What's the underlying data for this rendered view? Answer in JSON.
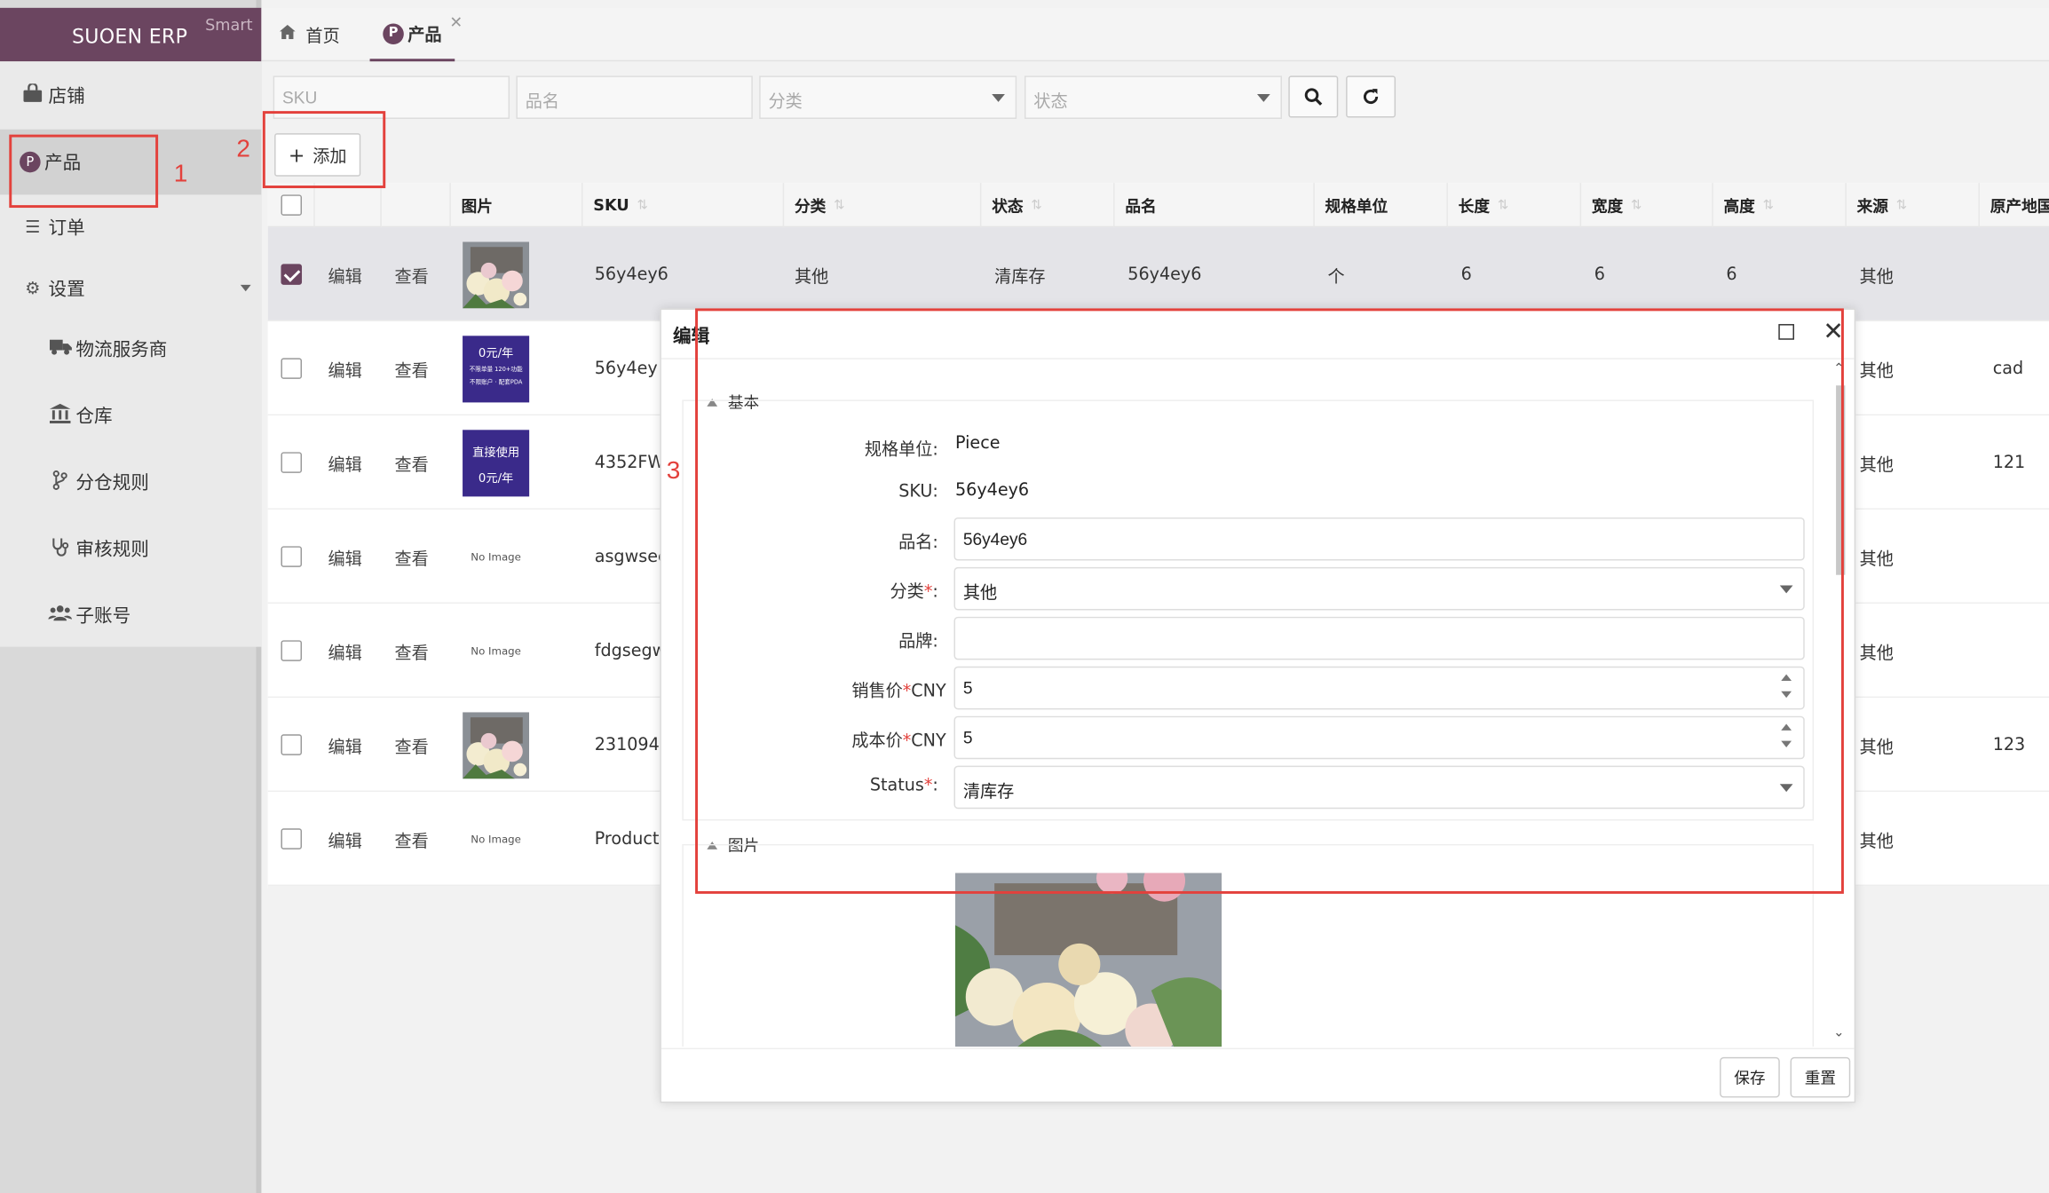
{
  "app": {
    "brand": "SUOEN ERP",
    "edition": "Smart"
  },
  "sidebar": {
    "items": [
      {
        "label": "店铺",
        "icon": "shopping-bag-icon"
      },
      {
        "label": "产品",
        "icon": "product-p-icon"
      },
      {
        "label": "订单",
        "icon": "list-icon"
      },
      {
        "label": "设置",
        "icon": "gear-icon"
      }
    ],
    "sub_items": [
      {
        "label": "物流服务商",
        "icon": "truck-icon"
      },
      {
        "label": "仓库",
        "icon": "bank-icon"
      },
      {
        "label": "分仓规则",
        "icon": "branch-icon"
      },
      {
        "label": "审核规则",
        "icon": "stethoscope-icon"
      },
      {
        "label": "子账号",
        "icon": "users-icon"
      }
    ]
  },
  "tabs": [
    {
      "label": "首页",
      "icon": "home-icon"
    },
    {
      "label": "产品",
      "icon": "product-p-icon",
      "active": true
    }
  ],
  "filters": {
    "sku_placeholder": "SKU",
    "name_placeholder": "品名",
    "category_placeholder": "分类",
    "status_placeholder": "状态"
  },
  "toolbar": {
    "add_label": "添加",
    "add_icon": "plus-icon"
  },
  "table": {
    "columns": [
      "图片",
      "SKU",
      "分类",
      "状态",
      "品名",
      "规格单位",
      "长度",
      "宽度",
      "高度",
      "来源",
      "原产地国"
    ],
    "edit_label": "编辑",
    "view_label": "查看",
    "no_image": "No Image",
    "rows": [
      {
        "checked": true,
        "image": "flowers",
        "sku": "56y4ey6",
        "category": "其他",
        "status": "清库存",
        "name": "56y4ey6",
        "unit": "个",
        "length": "6",
        "width": "6",
        "height": "6",
        "source": "其他",
        "origin": ""
      },
      {
        "checked": false,
        "image": "promo1",
        "sku": "56y4ey",
        "source": "其他",
        "origin": "cad"
      },
      {
        "checked": false,
        "image": "promo2",
        "sku": "4352FW",
        "source": "其他",
        "origin": "121"
      },
      {
        "checked": false,
        "image": "none",
        "sku": "asgwsee",
        "source": "其他",
        "origin": ""
      },
      {
        "checked": false,
        "image": "none",
        "sku": "fdgsegw",
        "source": "其他",
        "origin": ""
      },
      {
        "checked": false,
        "image": "flowers",
        "sku": "231094",
        "source": "其他",
        "origin": "123"
      },
      {
        "checked": false,
        "image": "none",
        "sku": "Product",
        "source": "其他",
        "origin": ""
      }
    ],
    "promo1": {
      "line1": "0元/年",
      "line2": "不限单量 120+功能",
      "line3": "不限账户 · 配套PDA"
    },
    "promo2": {
      "line1": "直接使用",
      "line2": "0元/年"
    }
  },
  "annotations": [
    "1",
    "2",
    "3"
  ],
  "modal": {
    "title": "编辑",
    "section_basic": "基本",
    "section_image": "图片",
    "fields": {
      "unit_label": "规格单位:",
      "unit_value": "Piece",
      "sku_label": "SKU:",
      "sku_value": "56y4ey6",
      "name_label": "品名:",
      "name_value": "56y4ey6",
      "category_label": "分类",
      "category_value": "其他",
      "brand_label": "品牌:",
      "brand_value": "",
      "price_label": "销售价",
      "price_suffix": "CNY",
      "price_value": "5",
      "cost_label": "成本价",
      "cost_suffix": "CNY",
      "cost_value": "5",
      "status_label": "Status",
      "status_value": "清库存",
      "required_mark": "*",
      "colon": ":"
    },
    "save_label": "保存",
    "reset_label": "重置"
  },
  "colors": {
    "brand": "#6b4560",
    "annotation": "#e3413c"
  }
}
